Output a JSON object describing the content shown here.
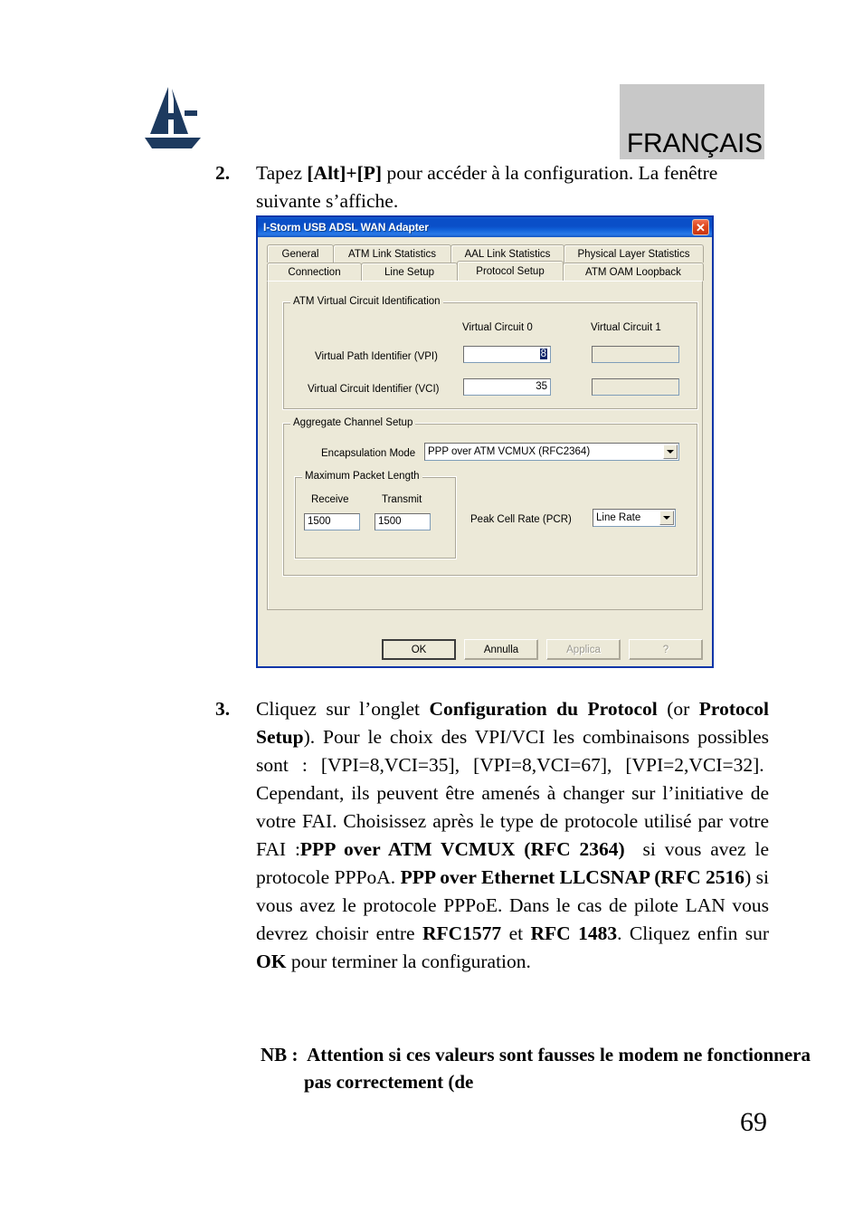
{
  "page": {
    "language_badge": "FRANÇAIS",
    "number": "69",
    "logo_name": "atlantis-land-logo"
  },
  "steps": [
    {
      "number": "2.",
      "html": "Tapez <b>[Alt]+[P]</b> pour accéder à la configuration. La fenêtre suivante s’affiche."
    },
    {
      "number": "3.",
      "html": "Cliquez sur l’onglet <b>Configuration du Protocol</b> (or <b>Protocol Setup</b>). Pour le choix des VPI/VCI les combinaisons possibles sont : [VPI=8,VCI=35], [VPI=8,VCI=67], [VPI=2,VCI=32].&nbsp; Cependant, ils peuvent être amenés à changer sur l’initiative de votre FAI. Choisissez après le type de protocole utilisé par votre FAI :<b>PPP over ATM VCMUX (RFC 2364)</b>&nbsp; si vous avez le protocole PPPoA. <b>PPP over Ethernet LLCSNAP (RFC 2516</b>) si vous avez le protocole PPPoE. Dans le cas de pilote LAN vous devrez choisir entre <b>RFC1577</b> et <b>RFC 1483</b>. Cliquez enfin sur <b>OK</b> pour terminer la configuration."
    }
  ],
  "note": {
    "html": "NB :&nbsp; Attention si ces valeurs sont fausses le modem ne fonctionnera pas correctement (de"
  },
  "dialog": {
    "title": "I-Storm USB ADSL WAN Adapter",
    "close_glyph": "✕",
    "tabs_row1": [
      {
        "label": "General",
        "active": false
      },
      {
        "label": "ATM Link Statistics",
        "active": false
      },
      {
        "label": "AAL Link Statistics",
        "active": false
      },
      {
        "label": "Physical Layer Statistics",
        "active": false
      }
    ],
    "tabs_row2": [
      {
        "label": "Connection",
        "active": false
      },
      {
        "label": "Line Setup",
        "active": false
      },
      {
        "label": "Protocol Setup",
        "active": true
      },
      {
        "label": "ATM OAM Loopback",
        "active": false
      }
    ],
    "vc_group": {
      "title": "ATM Virtual Circuit Identification",
      "column_0": "Virtual Circuit 0",
      "column_1": "Virtual Circuit 1",
      "vpi_label": "Virtual Path Identifier (VPI)",
      "vci_label": "Virtual Circuit Identifier (VCI)",
      "vpi_value_0": "8",
      "vci_value_0": "35",
      "vpi_value_1": "",
      "vci_value_1": ""
    },
    "aggregate_group": {
      "title": "Aggregate Channel Setup",
      "encapsulation_label": "Encapsulation Mode",
      "encapsulation_value": "PPP over ATM VCMUX (RFC2364)",
      "packet_group_title": "Maximum Packet Length",
      "receive_label": "Receive",
      "transmit_label": "Transmit",
      "receive_value": "1500",
      "transmit_value": "1500",
      "pcr_label": "Peak Cell Rate (PCR)",
      "pcr_value": "Line Rate"
    },
    "buttons": {
      "ok": "OK",
      "cancel": "Annulla",
      "apply": "Applica",
      "help": "?"
    },
    "colors": {
      "titlebar_blue": "#0a4fc8",
      "window_border": "#0a35a8",
      "face": "#ece9d8",
      "selection": "#0a246a",
      "close_red": "#c83510"
    }
  }
}
